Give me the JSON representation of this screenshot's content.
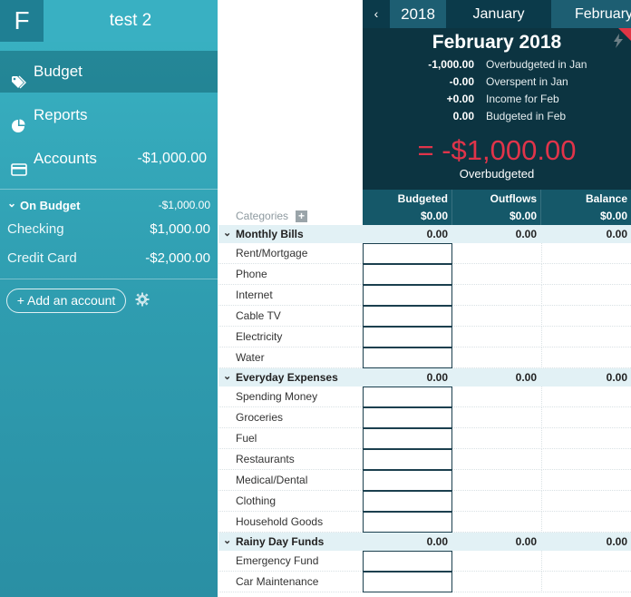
{
  "sidebar": {
    "logo_letter": "F",
    "budget_name": "test 2",
    "nav": {
      "budget_label": "Budget",
      "reports_label": "Reports",
      "accounts_label": "Accounts",
      "accounts_total": "-$1,000.00"
    },
    "on_budget": {
      "label": "On Budget",
      "total": "-$1,000.00"
    },
    "accounts": [
      {
        "name": "Checking",
        "balance": "$1,000.00"
      },
      {
        "name": "Credit Card",
        "balance": "-$2,000.00"
      }
    ],
    "add_account_label": "+ Add an account",
    "icons": [
      "tag-icon",
      "pie-chart-icon",
      "card-icon",
      "chevron-down-icon",
      "gear-icon"
    ]
  },
  "month_nav": {
    "prev_symbol": "‹",
    "year": "2018",
    "month_current": "January",
    "month_next": "February"
  },
  "summary": {
    "title": "February 2018",
    "rows": [
      {
        "value": "-1,000.00",
        "label": "Overbudgeted in Jan"
      },
      {
        "value": "-0.00",
        "label": "Overspent in Jan"
      },
      {
        "value": "+0.00",
        "label": "Income for Feb"
      },
      {
        "value": "0.00",
        "label": "Budgeted in Feb"
      }
    ],
    "total": "= -$1,000.00",
    "total_label": "Overbudgeted",
    "accent_color": "#e0344a"
  },
  "columns": {
    "categories_label": "Categories",
    "add_symbol": "+",
    "budgeted": {
      "title": "Budgeted",
      "total": "$0.00"
    },
    "outflows": {
      "title": "Outflows",
      "total": "$0.00"
    },
    "balance": {
      "title": "Balance",
      "total": "$0.00"
    }
  },
  "groups": [
    {
      "name": "Monthly Bills",
      "budgeted": "0.00",
      "outflows": "0.00",
      "balance": "0.00",
      "categories": [
        "Rent/Mortgage",
        "Phone",
        "Internet",
        "Cable TV",
        "Electricity",
        "Water"
      ]
    },
    {
      "name": "Everyday Expenses",
      "budgeted": "0.00",
      "outflows": "0.00",
      "balance": "0.00",
      "categories": [
        "Spending Money",
        "Groceries",
        "Fuel",
        "Restaurants",
        "Medical/Dental",
        "Clothing",
        "Household Goods"
      ]
    },
    {
      "name": "Rainy Day Funds",
      "budgeted": "0.00",
      "outflows": "0.00",
      "balance": "0.00",
      "categories": [
        "Emergency Fund",
        "Car Maintenance"
      ]
    }
  ]
}
